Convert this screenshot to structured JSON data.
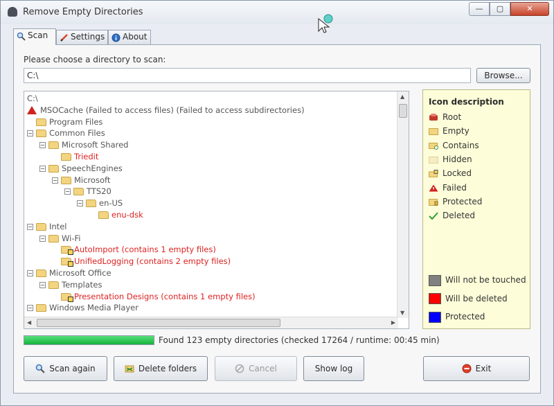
{
  "window": {
    "title": "Remove Empty Directories",
    "controls": {
      "minimize": "—",
      "maximize": "▢",
      "close": "✕"
    }
  },
  "tabs": [
    {
      "label": "Scan",
      "icon": "magnifier-icon",
      "active": true
    },
    {
      "label": "Settings",
      "icon": "pencil-icon",
      "active": false
    },
    {
      "label": "About",
      "icon": "info-icon",
      "active": false
    }
  ],
  "scan": {
    "prompt": "Please choose a directory to scan:",
    "path_value": "C:\\",
    "browse_label": "Browse..."
  },
  "tree": {
    "rows": [
      {
        "text": "C:\\",
        "style": "root"
      },
      {
        "text": "MSOCache (Failed to access files) (Failed to access subdirectories)",
        "style": "failed"
      },
      {
        "text": "Program Files",
        "style": "normal"
      },
      {
        "text": "Common Files",
        "style": "normal"
      },
      {
        "text": "Microsoft Shared",
        "style": "normal"
      },
      {
        "text": "Triedit",
        "style": "red"
      },
      {
        "text": "SpeechEngines",
        "style": "normal"
      },
      {
        "text": "Microsoft",
        "style": "normal"
      },
      {
        "text": "TTS20",
        "style": "normal"
      },
      {
        "text": "en-US",
        "style": "normal"
      },
      {
        "text": "enu-dsk",
        "style": "red"
      },
      {
        "text": "Intel",
        "style": "normal"
      },
      {
        "text": "Wi-Fi",
        "style": "normal"
      },
      {
        "text": "AutoImport (contains 1 empty files)",
        "style": "red"
      },
      {
        "text": "UnifiedLogging (contains 2 empty files)",
        "style": "red"
      },
      {
        "text": "Microsoft Office",
        "style": "normal"
      },
      {
        "text": "Templates",
        "style": "normal"
      },
      {
        "text": "Presentation Designs (contains 1 empty files)",
        "style": "red"
      },
      {
        "text": "Windows Media Player",
        "style": "normal"
      }
    ]
  },
  "legend": {
    "title": "Icon description",
    "icons": [
      {
        "label": "Root",
        "icon": "root-icon"
      },
      {
        "label": "Empty",
        "icon": "empty-folder-icon"
      },
      {
        "label": "Contains",
        "icon": "contains-folder-icon"
      },
      {
        "label": "Hidden",
        "icon": "hidden-folder-icon"
      },
      {
        "label": "Locked",
        "icon": "locked-folder-icon"
      },
      {
        "label": "Failed",
        "icon": "failed-icon"
      },
      {
        "label": "Protected",
        "icon": "protected-folder-icon"
      },
      {
        "label": "Deleted",
        "icon": "checkmark-icon"
      }
    ],
    "colors": [
      {
        "label": "Will not be touched",
        "color": "#808080"
      },
      {
        "label": "Will be deleted",
        "color": "#ff0000"
      },
      {
        "label": "Protected",
        "color": "#0000ff"
      }
    ]
  },
  "progress": {
    "fraction": 1.0
  },
  "status_text": "Found 123 empty directories (checked 17264 / runtime: 00:45 min)",
  "buttons": {
    "scan_again": "Scan again",
    "delete_folders": "Delete folders",
    "cancel": "Cancel",
    "show_log": "Show log",
    "exit": "Exit"
  }
}
